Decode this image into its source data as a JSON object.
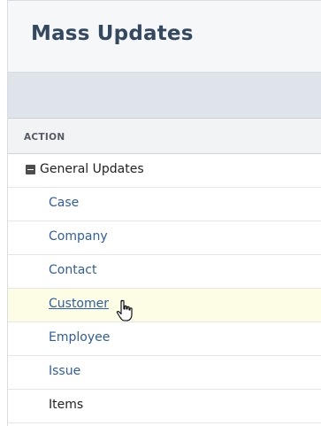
{
  "page": {
    "title": "Mass Updates"
  },
  "table": {
    "header": "ACTION",
    "group": {
      "label": "General Updates",
      "icon": "collapse-icon",
      "items": [
        {
          "label": "Case"
        },
        {
          "label": "Company"
        },
        {
          "label": "Contact"
        },
        {
          "label": "Customer"
        },
        {
          "label": "Employee"
        },
        {
          "label": "Issue"
        },
        {
          "label": "Items"
        }
      ]
    }
  },
  "colors": {
    "title": "#34495f",
    "link": "#2e5ea4",
    "hover_row": "#fdfde6"
  },
  "cursor": {
    "icon": "hand-pointer-icon"
  }
}
